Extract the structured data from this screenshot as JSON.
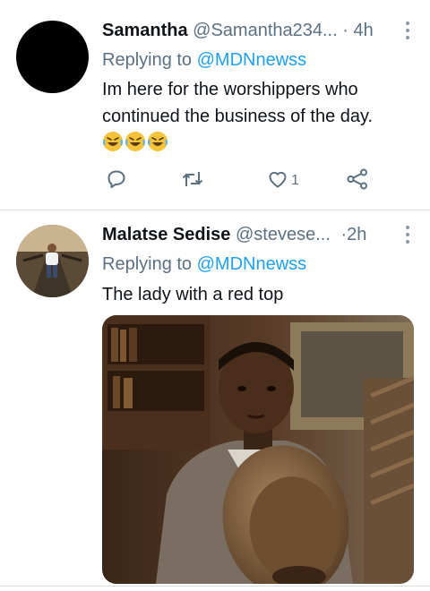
{
  "tweets": [
    {
      "name": "Samantha",
      "handle": "@Samantha234...",
      "sep": "·",
      "time": "4h",
      "replying_prefix": "Replying to",
      "replying_to": "@MDNnewss",
      "text": "Im here for  the worshippers who continued the business of the day.",
      "emojis": [
        "rolling-on-floor-laughing-emoji",
        "rolling-on-floor-laughing-emoji",
        "rolling-on-floor-laughing-emoji"
      ],
      "like_count": "1",
      "icons": {
        "reply": "comment-icon",
        "retweet": "retweet-icon",
        "like": "heart-icon",
        "share": "share-icon",
        "more": "more-vertical-icon"
      }
    },
    {
      "name": "Malatse Sedise",
      "handle": "@stevese...",
      "sep": "·",
      "time": "2h",
      "replying_prefix": "Replying to",
      "replying_to": "@MDNnewss",
      "text": "The lady with a red top",
      "media": "photo-boy-holding-hat",
      "icons": {
        "more": "more-vertical-icon"
      }
    }
  ],
  "colors": {
    "link": "#1da1f2",
    "muted": "#5b7083",
    "text": "#0f1419",
    "divider": "#d7dde3"
  }
}
